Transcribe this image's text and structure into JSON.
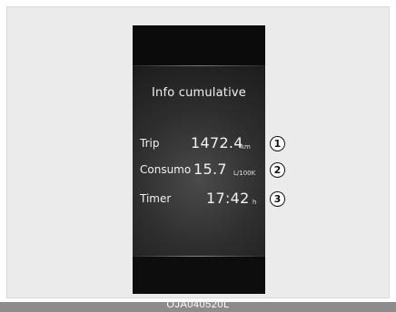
{
  "display": {
    "title": "Info cumulative",
    "rows": [
      {
        "label": "Trip",
        "value": "1472.4",
        "unit": "km",
        "callout": "1"
      },
      {
        "label": "Consumo",
        "value": "15.7",
        "unit": "L/100K",
        "callout": "2"
      },
      {
        "label": "Timer",
        "value": "17:42",
        "unit": "h",
        "callout": "3"
      }
    ]
  },
  "caption": "OJA040520L"
}
